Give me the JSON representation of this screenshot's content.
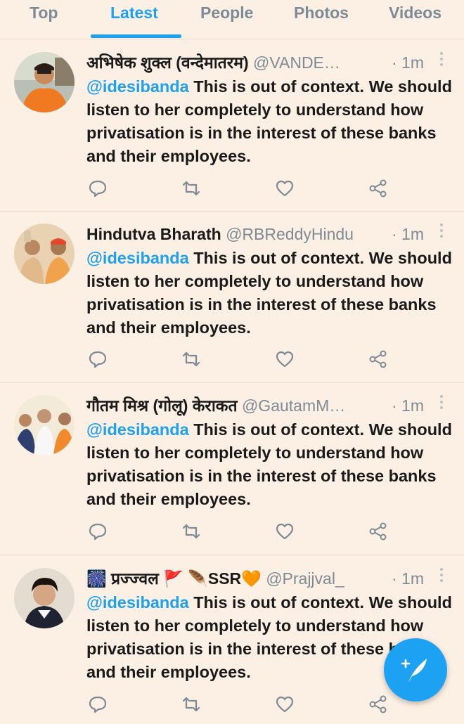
{
  "tabs": [
    {
      "label": "Top",
      "active": false
    },
    {
      "label": "Latest",
      "active": true
    },
    {
      "label": "People",
      "active": false
    },
    {
      "label": "Photos",
      "active": false
    },
    {
      "label": "Videos",
      "active": false
    }
  ],
  "tweets": [
    {
      "name": "अभिषेक शुक्ल (वन्देमातरम)",
      "handle": "@VANDE…",
      "time": "· 1m",
      "mention": "@idesibanda",
      "text": " This is out of context. We should listen to her completely to understand how privatisation is in the interest of these banks and their employees."
    },
    {
      "name": "Hindutva Bharath",
      "handle": "@RBReddyHindu",
      "time": "· 1m",
      "mention": "@idesibanda",
      "text": " This is out of context. We should listen to her completely to understand how privatisation is in the interest of these banks and their employees."
    },
    {
      "name": "गौतम मिश्र (गोलू) केराकत",
      "handle": "@GautamM…",
      "time": "· 1m",
      "mention": "@idesibanda",
      "text": " This is out of context. We should listen to her completely to understand how privatisation is in the interest of these banks and their employees."
    },
    {
      "name": "🎆 प्रज्ज्वल 🚩 🪶SSR🧡",
      "handle": "@Prajjval_",
      "time": "· 1m",
      "mention": "@idesibanda",
      "text": " This is out of context. We should listen to her completely to understand how privatisation is in the interest of these banks and their employees."
    }
  ],
  "icons": {
    "reply": "reply-icon",
    "retweet": "retweet-icon",
    "like": "like-icon",
    "share": "share-icon",
    "more": "more-vertical-icon",
    "compose": "compose-tweet-icon"
  },
  "colors": {
    "accent": "#1da1f2",
    "background": "#fcefe3",
    "muted": "#7d8b96"
  }
}
